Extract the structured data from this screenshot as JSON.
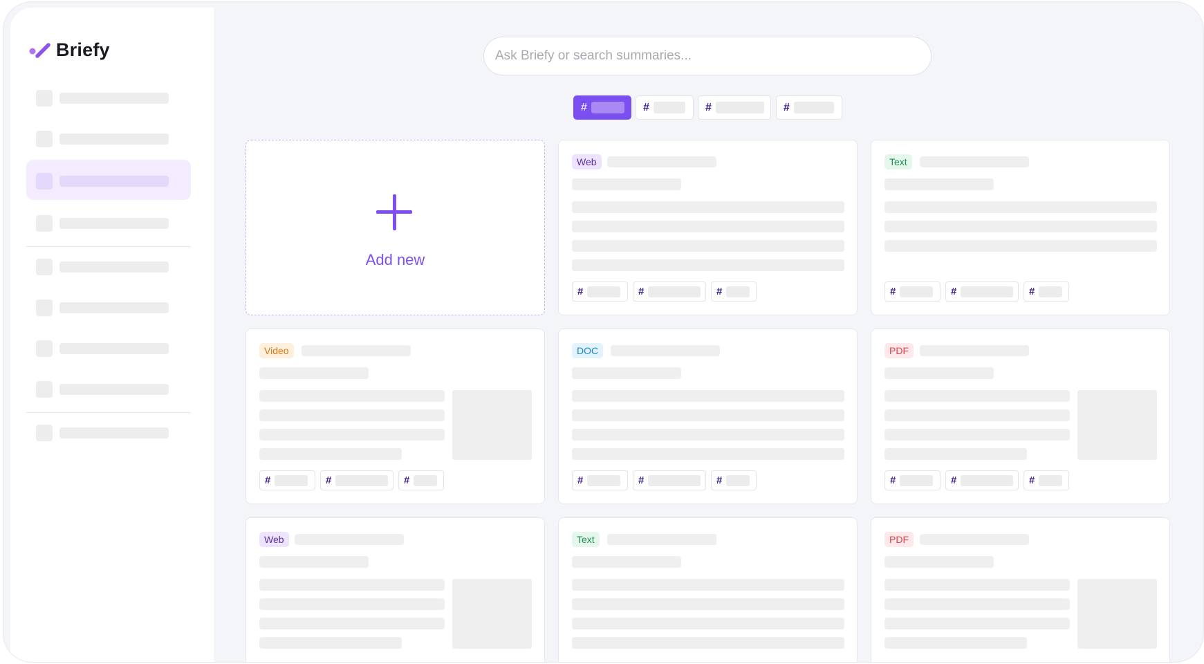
{
  "app": {
    "name": "Briefy",
    "brand_color": "#7b4ef0"
  },
  "search": {
    "placeholder": "Ask Briefy or search summaries..."
  },
  "filters": {
    "symbol": "#"
  },
  "add_card": {
    "label": "Add new",
    "icon": "plus-icon"
  },
  "cards": [
    {
      "type": "Web"
    },
    {
      "type": "Text"
    },
    {
      "type": "Video"
    },
    {
      "type": "DOC"
    },
    {
      "type": "PDF"
    },
    {
      "type": "Web"
    },
    {
      "type": "Text"
    },
    {
      "type": "PDF"
    }
  ]
}
